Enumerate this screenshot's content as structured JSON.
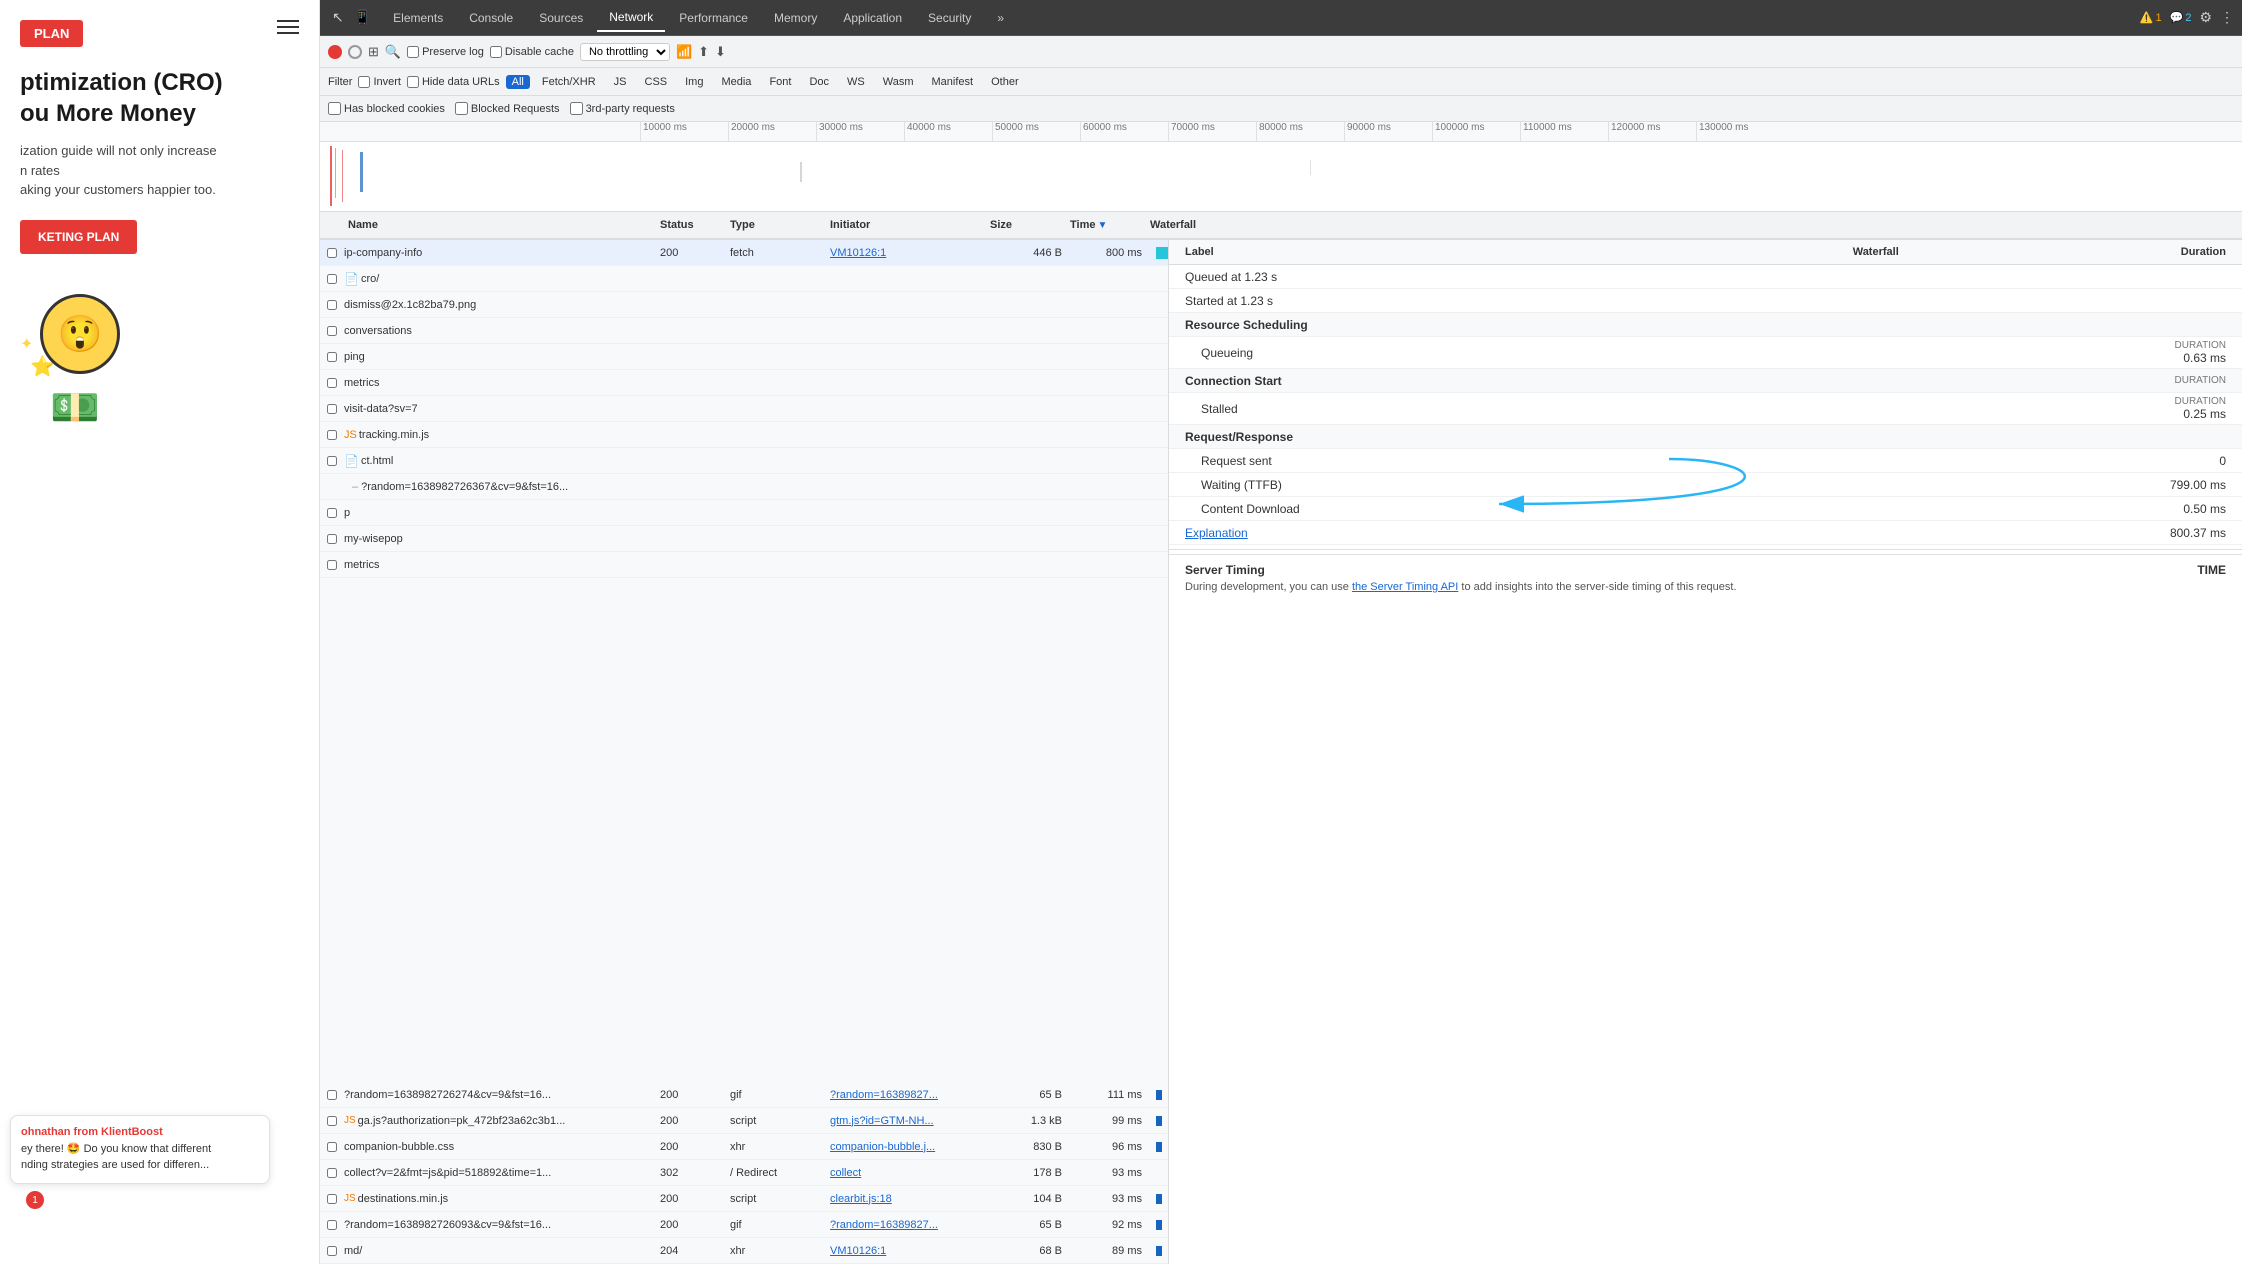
{
  "left_panel": {
    "plan_badge": "PLAN",
    "headline_line1": "ptimization (CRO)",
    "headline_line2": "ou More Money",
    "subtext_line1": "ization guide will not only increase",
    "subtext_line2": "n rates",
    "subtext_line3": "aking your customers happier too.",
    "cta_label": "KETING PLAN",
    "chat": {
      "from_label": "ohnathan from KlientBoost",
      "text": "ey there! 🤩 Do you know that different",
      "text2": "nding strategies are used for differen..."
    },
    "notif_count": "1"
  },
  "devtools": {
    "tabs": [
      {
        "label": "Elements",
        "active": false
      },
      {
        "label": "Console",
        "active": false
      },
      {
        "label": "Sources",
        "active": false
      },
      {
        "label": "Network",
        "active": true
      },
      {
        "label": "Performance",
        "active": false
      },
      {
        "label": "Memory",
        "active": false
      },
      {
        "label": "Application",
        "active": false
      },
      {
        "label": "Security",
        "active": false
      },
      {
        "label": "»",
        "active": false
      }
    ],
    "warning_count": "1",
    "info_count": "2",
    "toolbar": {
      "preserve_log": "Preserve log",
      "disable_cache": "Disable cache",
      "throttle": "No throttling"
    },
    "filter_bar": {
      "filter_label": "Filter",
      "invert": "Invert",
      "hide_data_urls": "Hide data URLs",
      "types": [
        "All",
        "Fetch/XHR",
        "JS",
        "CSS",
        "Img",
        "Media",
        "Font",
        "Doc",
        "WS",
        "Wasm",
        "Manifest",
        "Other"
      ],
      "active_type": "All"
    },
    "blocked_bar": {
      "has_blocked": "Has blocked cookies",
      "blocked_requests": "Blocked Requests",
      "third_party": "3rd-party requests"
    },
    "timeline": {
      "ticks": [
        "10000 ms",
        "20000 ms",
        "30000 ms",
        "40000 ms",
        "50000 ms",
        "60000 ms",
        "70000 ms",
        "80000 ms",
        "90000 ms",
        "100000 ms",
        "110000 ms",
        "120000 ms",
        "130000 ms"
      ]
    },
    "table_headers": {
      "name": "Name",
      "status": "Status",
      "type": "Type",
      "initiator": "Initiator",
      "size": "Size",
      "time": "Time",
      "waterfall": "Waterfall"
    },
    "files": [
      {
        "name": "ip-company-info",
        "status": "200",
        "type": "fetch",
        "initiator": "VM10126:1",
        "size": "446 B",
        "time": "800 ms",
        "icon": "none",
        "has_waterfall": true
      },
      {
        "name": "cro/",
        "status": "",
        "type": "",
        "initiator": "",
        "size": "",
        "time": "",
        "icon": "doc"
      },
      {
        "name": "dismiss@2x.1c82ba79.png",
        "status": "",
        "type": "",
        "initiator": "",
        "size": "",
        "time": "",
        "icon": "none"
      },
      {
        "name": "conversations",
        "status": "",
        "type": "",
        "initiator": "",
        "size": "",
        "time": "",
        "icon": "none"
      },
      {
        "name": "ping",
        "status": "",
        "type": "",
        "initiator": "",
        "size": "",
        "time": "",
        "icon": "none"
      },
      {
        "name": "metrics",
        "status": "",
        "type": "",
        "initiator": "",
        "size": "",
        "time": "",
        "icon": "none"
      },
      {
        "name": "visit-data?sv=7",
        "status": "",
        "type": "",
        "initiator": "",
        "size": "",
        "time": "",
        "icon": "none"
      },
      {
        "name": "tracking.min.js",
        "status": "",
        "type": "",
        "initiator": "",
        "size": "",
        "time": "",
        "icon": "js"
      },
      {
        "name": "ct.html",
        "status": "",
        "type": "",
        "initiator": "",
        "size": "",
        "time": "",
        "icon": "doc"
      },
      {
        "name": "?random=1638982726367&cv=9&fst=16...",
        "status": "",
        "type": "",
        "initiator": "",
        "size": "",
        "time": "",
        "icon": "sub"
      },
      {
        "name": "p",
        "status": "",
        "type": "",
        "initiator": "",
        "size": "",
        "time": "",
        "icon": "none"
      },
      {
        "name": "my-wisepop",
        "status": "",
        "type": "",
        "initiator": "",
        "size": "",
        "time": "",
        "icon": "none"
      },
      {
        "name": "metrics",
        "status": "",
        "type": "",
        "initiator": "",
        "size": "",
        "time": "",
        "icon": "none"
      }
    ],
    "lower_rows": [
      {
        "name": "?random=1638982726274&cv=9&fst=16...",
        "status": "200",
        "type": "gif",
        "initiator": "?random=16389827...",
        "size": "65 B",
        "time": "111 ms",
        "has_waterfall": true
      },
      {
        "name": "ga.js?authorization=pk_472bf23a62c3b1...",
        "status": "200",
        "type": "script",
        "initiator": "gtm.js?id=GTM-NH...",
        "size": "1.3 kB",
        "time": "99 ms",
        "has_waterfall": true
      },
      {
        "name": "companion-bubble.css",
        "status": "200",
        "type": "xhr",
        "initiator": "companion-bubble.j...",
        "size": "830 B",
        "time": "96 ms",
        "has_waterfall": true
      },
      {
        "name": "collect?v=2&fmt=js&pid=518892&time=1...",
        "status": "302",
        "type": "/ Redirect",
        "initiator": "collect",
        "size": "178 B",
        "time": "93 ms",
        "has_waterfall": false
      },
      {
        "name": "destinations.min.js",
        "status": "200",
        "type": "script",
        "initiator": "clearbit.js:18",
        "size": "104 B",
        "time": "93 ms",
        "has_waterfall": true
      },
      {
        "name": "?random=1638982726093&cv=9&fst=16...",
        "status": "200",
        "type": "gif",
        "initiator": "?random=16389827...",
        "size": "65 B",
        "time": "92 ms",
        "has_waterfall": true
      },
      {
        "name": "md/",
        "status": "204",
        "type": "xhr",
        "initiator": "VM10126:1",
        "size": "68 B",
        "time": "89 ms",
        "has_waterfall": true
      }
    ],
    "detail": {
      "headers": {
        "label": "Label",
        "waterfall": "Waterfall",
        "duration": "Duration"
      },
      "timing_rows": [
        {
          "label": "Queued at 1.23 s",
          "waterfall": "",
          "duration": ""
        },
        {
          "label": "Started at 1.23 s",
          "waterfall": "",
          "duration": ""
        },
        {
          "label": "Resource Scheduling",
          "waterfall": "",
          "duration": ""
        },
        {
          "label": "Queueing",
          "waterfall": "",
          "duration": "0.63 ms",
          "duration_label": "DURATION"
        },
        {
          "label": "Connection Start",
          "waterfall": "",
          "duration": "",
          "duration_label": "DURATION"
        },
        {
          "label": "Stalled",
          "waterfall": "",
          "duration": "0.25 ms",
          "duration_label": "DURATION"
        },
        {
          "label": "Request/Response",
          "waterfall": "",
          "duration": ""
        },
        {
          "label": "Request sent",
          "waterfall": "",
          "duration": "0"
        },
        {
          "label": "Waiting (TTFB)",
          "waterfall": "",
          "duration": "799.00 ms"
        },
        {
          "label": "Content Download",
          "waterfall": "",
          "duration": "0.50 ms"
        },
        {
          "label": "Explanation",
          "is_link": true,
          "waterfall": "",
          "duration": "800.37 ms"
        }
      ],
      "server_timing": {
        "label": "Server Timing",
        "time_label": "TIME",
        "text": "During development, you can use ",
        "link_text": "the Server Timing API",
        "text2": " to add insights into the server-side timing of this request."
      }
    }
  }
}
